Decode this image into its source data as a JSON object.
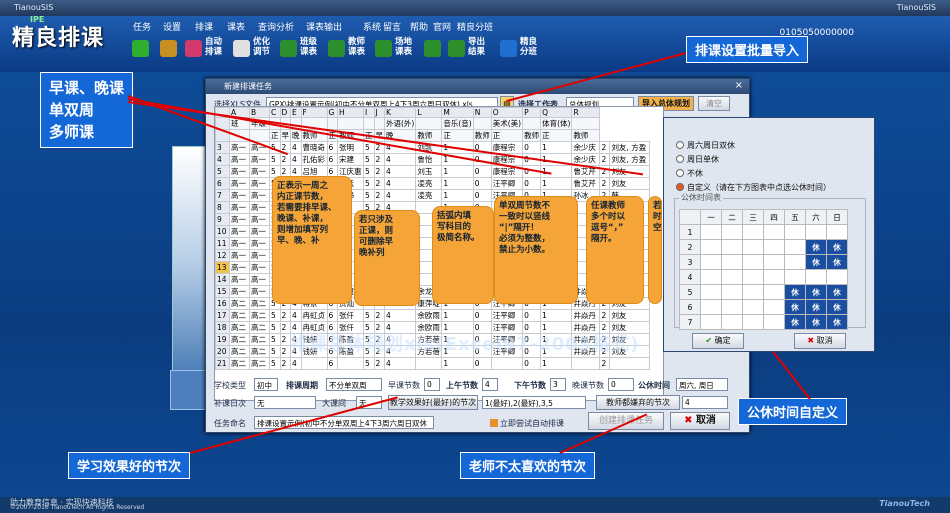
{
  "window": {
    "title": "TianouSIS",
    "right_title": "TianouSIS",
    "phone": "0105050000000"
  },
  "app": {
    "name": "精良排课",
    "edition": "IPE"
  },
  "menu": [
    "任务",
    "设置",
    "排课",
    "课表",
    "查询分析",
    "课表输出",
    "系统",
    "留言",
    "帮助",
    "官网",
    "精良分班"
  ],
  "toolbar": [
    {
      "l1": "",
      "l2": "",
      "icon": "add-icon",
      "color": "#2eb02e"
    },
    {
      "l1": "",
      "l2": "",
      "icon": "import-icon",
      "color": "#c89020"
    },
    {
      "l1": "自动",
      "l2": "排课",
      "icon": "auto-schedule-icon",
      "color": "#d23a6c"
    },
    {
      "l1": "优化",
      "l2": "调节",
      "icon": "optimize-icon",
      "color": "#e0e0e0"
    },
    {
      "l1": "班级",
      "l2": "课表",
      "icon": "class-table-icon",
      "color": "#2c8f2c"
    },
    {
      "l1": "教师",
      "l2": "课表",
      "icon": "teacher-table-icon",
      "color": "#2c8f2c"
    },
    {
      "l1": "场地",
      "l2": "课表",
      "icon": "venue-table-icon",
      "color": "#2c8f2c"
    },
    {
      "l1": "",
      "l2": "",
      "icon": "save-icon",
      "color": "#2c8f2c"
    },
    {
      "l1": "导出",
      "l2": "结果",
      "icon": "export-icon",
      "color": "#2c8f2c"
    },
    {
      "l1": "精良",
      "l2": "分班",
      "icon": "class-split-icon",
      "color": "#1f6fd1"
    }
  ],
  "dialog": {
    "title": "新建排课任务",
    "select_xls_label": "选择XLS文件",
    "xls_file": "GPX\\排课设置示例(初中不分单双周上4下3周六周日双休).xls",
    "select_sheet_label": "选择工作表",
    "sheet_value": "总体规划",
    "import_button": "导入总体规划",
    "clear_button": "清空",
    "school_type_label": "学校类型",
    "school_type": "初中",
    "cycle_label": "排课周期",
    "cycle": "不分单双周",
    "morning_label": "早课节数",
    "morning": "0",
    "am_label": "上午节数",
    "am": "4",
    "pm_label": "下午节数",
    "pm": "3",
    "evening_label": "晚课节数",
    "evening": "0",
    "rest_label": "公休时间",
    "rest": "周六, 周日",
    "makeup_label": "补课日次",
    "makeup": "无",
    "bigweek_label": "大课间",
    "bigweek": "无",
    "best_label": "教学效果好(最好)的节次",
    "best": "1(最好),2(最好),3,5",
    "teacher_label": "教师都嫌弃的节次",
    "teacher": "4",
    "taskname_label": "任务命名",
    "taskname": "排课设置示例(初中不分单双周上4下3周六周日双休",
    "auto_check": "立即尝试自动排课",
    "create_button": "创建排课任务",
    "cancel_button": "取消"
  },
  "sheet": {
    "cols": [
      "",
      "A",
      "B",
      "C",
      "D",
      "E",
      "F",
      "G",
      "H",
      "I",
      "J",
      "K",
      "L",
      "M",
      "N",
      "O",
      "P",
      "Q",
      "R"
    ],
    "header1": [
      "班",
      "年级",
      "",
      "",
      "",
      "",
      "",
      "",
      "",
      "",
      "外语(外)",
      "",
      "音乐(音)",
      "",
      "美术(美)",
      "",
      "体育(体)",
      ""
    ],
    "header2": [
      "",
      "",
      "正",
      "早",
      "晚",
      "教师",
      "正",
      "教师",
      "正",
      "早",
      "晚",
      "教师",
      "正",
      "教师",
      "正",
      "教师",
      "正",
      "教师"
    ],
    "rows": [
      [
        "3",
        "高一",
        "高一",
        "5",
        "2",
        "4",
        "曹晓奇",
        "6",
        "张明",
        "5",
        "2",
        "4",
        "刘凯",
        "1",
        "0",
        "康程宗",
        "0",
        "1",
        "余少庆",
        "2",
        "刘友, 方盈"
      ],
      [
        "4",
        "高一",
        "高一",
        "5",
        "2",
        "4",
        "孔佑彩",
        "6",
        "宋建",
        "5",
        "2",
        "4",
        "鲁怡",
        "1",
        "0",
        "康程宗",
        "0",
        "1",
        "余少庆",
        "2",
        "刘友, 方盈"
      ],
      [
        "5",
        "高一",
        "高一",
        "5",
        "2",
        "4",
        "吕旭",
        "6",
        "江庆惠",
        "5",
        "2",
        "4",
        "刘玉",
        "1",
        "0",
        "康程宗",
        "0",
        "1",
        "鲁艾芹",
        "2",
        "刘友"
      ],
      [
        "6",
        "高一",
        "高一",
        "5",
        "2",
        "4",
        "孔佑",
        "6",
        "王跃",
        "5",
        "2",
        "4",
        "凌亮",
        "1",
        "0",
        "汪平卿",
        "0",
        "1",
        "鲁艾芹",
        "2",
        "刘友"
      ],
      [
        "7",
        "高一",
        "高一",
        "5",
        "2",
        "4",
        "刘姗",
        "6",
        "王书",
        "5",
        "2",
        "4",
        "凌亮",
        "1",
        "0",
        "汪平卿",
        "0",
        "1",
        "孙冰",
        "2",
        "韩"
      ],
      [
        "8",
        "高一",
        "高一",
        "5",
        "2",
        "4",
        "",
        "6",
        "",
        "5",
        "2",
        "4",
        "",
        "1",
        "0",
        "",
        "0",
        "1",
        "",
        "2",
        ""
      ],
      [
        "9",
        "高一",
        "高一",
        "5",
        "2",
        "4",
        "",
        "6",
        "",
        "5",
        "2",
        "4",
        "",
        "1",
        "0",
        "",
        "0",
        "1",
        "",
        "2",
        ""
      ],
      [
        "10",
        "高一",
        "高一",
        "5",
        "2",
        "4",
        "",
        "6",
        "",
        "5",
        "2",
        "4",
        "",
        "1",
        "0",
        "",
        "0",
        "1",
        "",
        "2",
        ""
      ],
      [
        "11",
        "高一",
        "高一",
        "5",
        "2",
        "4",
        "",
        "6",
        "",
        "5",
        "2",
        "4",
        "",
        "1",
        "0",
        "",
        "0",
        "1",
        "",
        "2",
        ""
      ],
      [
        "12",
        "高一",
        "高一",
        "5",
        "2",
        "4",
        "",
        "6",
        "",
        "5",
        "2",
        "4",
        "",
        "1",
        "0",
        "",
        "0",
        "1",
        "",
        "2",
        ""
      ],
      [
        "13",
        "高一",
        "高一",
        "5",
        "2",
        "4",
        "",
        "6",
        "",
        "5",
        "2",
        "4",
        "",
        "1",
        "0",
        "",
        "0",
        "1",
        "",
        "2",
        ""
      ],
      [
        "14",
        "高一",
        "高一",
        "5",
        "2",
        "4",
        "",
        "6",
        "",
        "5",
        "2",
        "4",
        "",
        "1",
        "0",
        "",
        "0",
        "1",
        "",
        "2",
        ""
      ],
      [
        "15",
        "高一",
        "高一",
        "5",
        "2",
        "4",
        "蒋景",
        "6",
        "宋翼",
        "5",
        "2",
        "4",
        "余龙",
        "1",
        "0",
        "汪平卿",
        "0",
        "1",
        "井焱丹",
        "2",
        "刘友"
      ],
      [
        "16",
        "高二",
        "高二",
        "5",
        "2",
        "4",
        "蒋景",
        "6",
        "费灿",
        "5",
        "2",
        "4",
        "康萍啶",
        "1",
        "0",
        "汪平卿",
        "0",
        "1",
        "井焱丹",
        "2",
        "刘友"
      ],
      [
        "17",
        "高二",
        "高二",
        "5",
        "2",
        "4",
        "冉虹贞",
        "6",
        "张仟",
        "5",
        "2",
        "4",
        "余欧雨",
        "1",
        "0",
        "汪平卿",
        "0",
        "1",
        "井焱丹",
        "2",
        "刘友"
      ],
      [
        "18",
        "高二",
        "高二",
        "5",
        "2",
        "4",
        "冉虹贞",
        "6",
        "张仟",
        "5",
        "2",
        "4",
        "余欧雨",
        "1",
        "0",
        "汪平卿",
        "0",
        "1",
        "井焱丹",
        "2",
        "刘友"
      ],
      [
        "19",
        "高二",
        "高二",
        "5",
        "2",
        "4",
        "钱妍",
        "6",
        "陈盈",
        "5",
        "2",
        "4",
        "方若蓓",
        "1",
        "0",
        "汪平卿",
        "0",
        "1",
        "井焱丹",
        "2",
        "刘友"
      ],
      [
        "20",
        "高二",
        "高二",
        "5",
        "2",
        "4",
        "钱妍",
        "6",
        "陈盈",
        "5",
        "2",
        "4",
        "方若蓓",
        "1",
        "0",
        "汪平卿",
        "0",
        "1",
        "井焱丹",
        "2",
        "刘友"
      ],
      [
        "21",
        "高二",
        "高二",
        "5",
        "2",
        "4",
        "",
        "6",
        "",
        "5",
        "2",
        "4",
        "",
        "1",
        "0",
        "",
        "0",
        "1",
        "",
        "2",
        ""
      ]
    ]
  },
  "bubbles": [
    {
      "lines": [
        "正表示一周之",
        "内正课节数，",
        "若需要排早课、",
        "晚课、补课，",
        "则增加填写列",
        "早、晚、补"
      ]
    },
    {
      "lines": [
        "若只涉及",
        "正课，则",
        "可删除早",
        "晚补列"
      ]
    },
    {
      "lines": [
        "括弧内填",
        "写科目的",
        "极简名称。"
      ]
    },
    {
      "lines": [
        "单双周节数不",
        "一致时以竖线",
        "“|”隔开！",
        "必须为整数，",
        "禁止为小数。"
      ]
    },
    {
      "lines": [
        "任课教师",
        "多个时以",
        "逗号“，”",
        "隔开。"
      ]
    },
    {
      "lines": [
        "若",
        "时",
        "空"
      ]
    }
  ],
  "callouts": {
    "batch_import": "排课设置批量导入",
    "left_lines": [
      "早课、晚课",
      "单双周",
      "多师课"
    ],
    "rest_custom": "公休时间自定义",
    "best_periods": "学习效果好的节次",
    "teacher_dislike": "老师不太喜欢的节次",
    "overlay": "排课总体规划xls(Excel97-2003格式)"
  },
  "rest_panel": {
    "options": [
      "周六周日双休",
      "周日单休",
      "不休",
      "自定义（请在下方图表中点选公休时间）"
    ],
    "selected": 3,
    "group_title": "公休时间表",
    "days": [
      "一",
      "二",
      "三",
      "四",
      "五",
      "六",
      "日"
    ],
    "periods": [
      "1",
      "2",
      "3",
      "4",
      "5",
      "6",
      "7"
    ],
    "off_label": "休",
    "ok": "确定",
    "cancel": "取消"
  },
  "status": {
    "line1": "助力教育信息 · 实现快速科技",
    "line2": "©2007-2016 TianouTech All Rights Reserved",
    "brand": "TianouTech"
  }
}
